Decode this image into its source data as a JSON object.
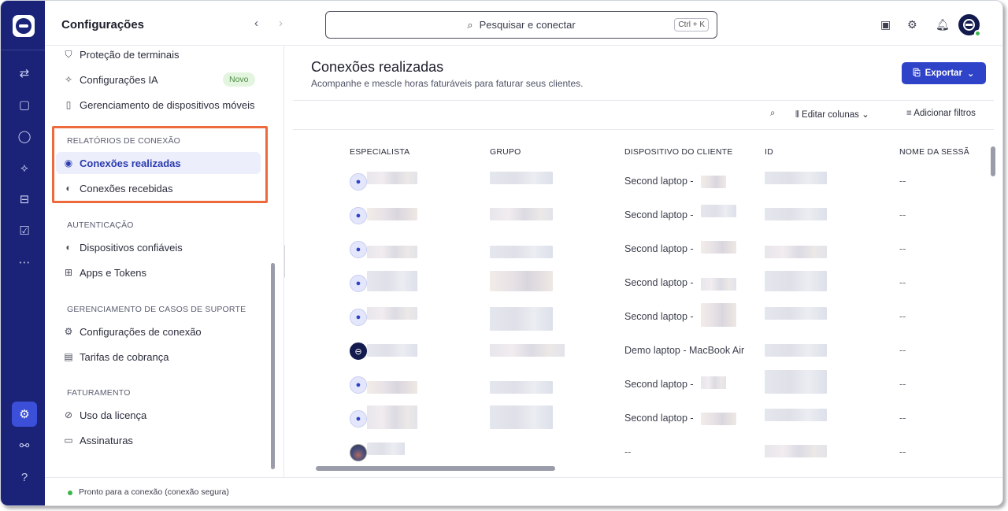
{
  "app": {
    "sidebar_title": "Configurações",
    "search_placeholder": "Pesquisar e conectar",
    "search_shortcut": "Ctrl + K"
  },
  "sidebar": {
    "top_items": [
      {
        "label": "Proteção de terminais",
        "icon": "shield-icon"
      },
      {
        "label": "Configurações IA",
        "icon": "sparkle-icon",
        "badge": "Novo"
      },
      {
        "label": "Gerenciamento de dispositivos móveis",
        "icon": "mobile-device-icon"
      }
    ],
    "sections": [
      {
        "title": "RELATÓRIOS DE CONEXÃO",
        "items": [
          {
            "label": "Conexões realizadas",
            "icon": "outgoing-connection-icon",
            "active": true
          },
          {
            "label": "Conexões recebidas",
            "icon": "incoming-connection-icon"
          }
        ]
      },
      {
        "title": "AUTENTICAÇÃO",
        "items": [
          {
            "label": "Dispositivos confiáveis",
            "icon": "trusted-device-icon"
          },
          {
            "label": "Apps e Tokens",
            "icon": "apps-icon"
          }
        ]
      },
      {
        "title": "GERENCIAMENTO DE CASOS DE SUPORTE",
        "items": [
          {
            "label": "Configurações de conexão",
            "icon": "connection-settings-icon"
          },
          {
            "label": "Tarifas de cobrança",
            "icon": "billing-rates-icon"
          }
        ]
      },
      {
        "title": "FATURAMENTO",
        "items": [
          {
            "label": "Uso da licença",
            "icon": "license-icon"
          },
          {
            "label": "Assinaturas",
            "icon": "subscriptions-icon"
          }
        ]
      }
    ]
  },
  "main": {
    "title": "Conexões realizadas",
    "subtitle": "Acompanhe e mescle horas faturáveis para faturar seus clientes.",
    "export_label": "Exportar",
    "edit_columns_label": "Editar colunas",
    "add_filters_label": "Adicionar filtros",
    "columns": [
      "ESPECIALISTA",
      "GRUPO",
      "DISPOSITIVO DO CLIENTE",
      "ID",
      "NOME DA SESSÃ"
    ],
    "rows": [
      {
        "device": "Second laptop -",
        "session": "--",
        "avatar": "user"
      },
      {
        "device": "Second laptop -",
        "session": "--",
        "avatar": "user"
      },
      {
        "device": "Second laptop -",
        "session": "--",
        "avatar": "user"
      },
      {
        "device": "Second laptop -",
        "session": "--",
        "avatar": "user"
      },
      {
        "device": "Second laptop -",
        "session": "--",
        "avatar": "user"
      },
      {
        "device": "Demo laptop - MacBook Air",
        "session": "--",
        "avatar": "app"
      },
      {
        "device": "Second laptop -",
        "session": "--",
        "avatar": "user"
      },
      {
        "device": "Second laptop -",
        "session": "--",
        "avatar": "user"
      },
      {
        "device": "--",
        "session": "--",
        "avatar": "photo"
      }
    ]
  },
  "status": {
    "text": "Pronto para a conexão (conexão segura)"
  },
  "colors": {
    "rail": "#1a2378",
    "accent": "#2f43c8",
    "highlight": "#ec6a3c",
    "online": "#3cb54a"
  }
}
